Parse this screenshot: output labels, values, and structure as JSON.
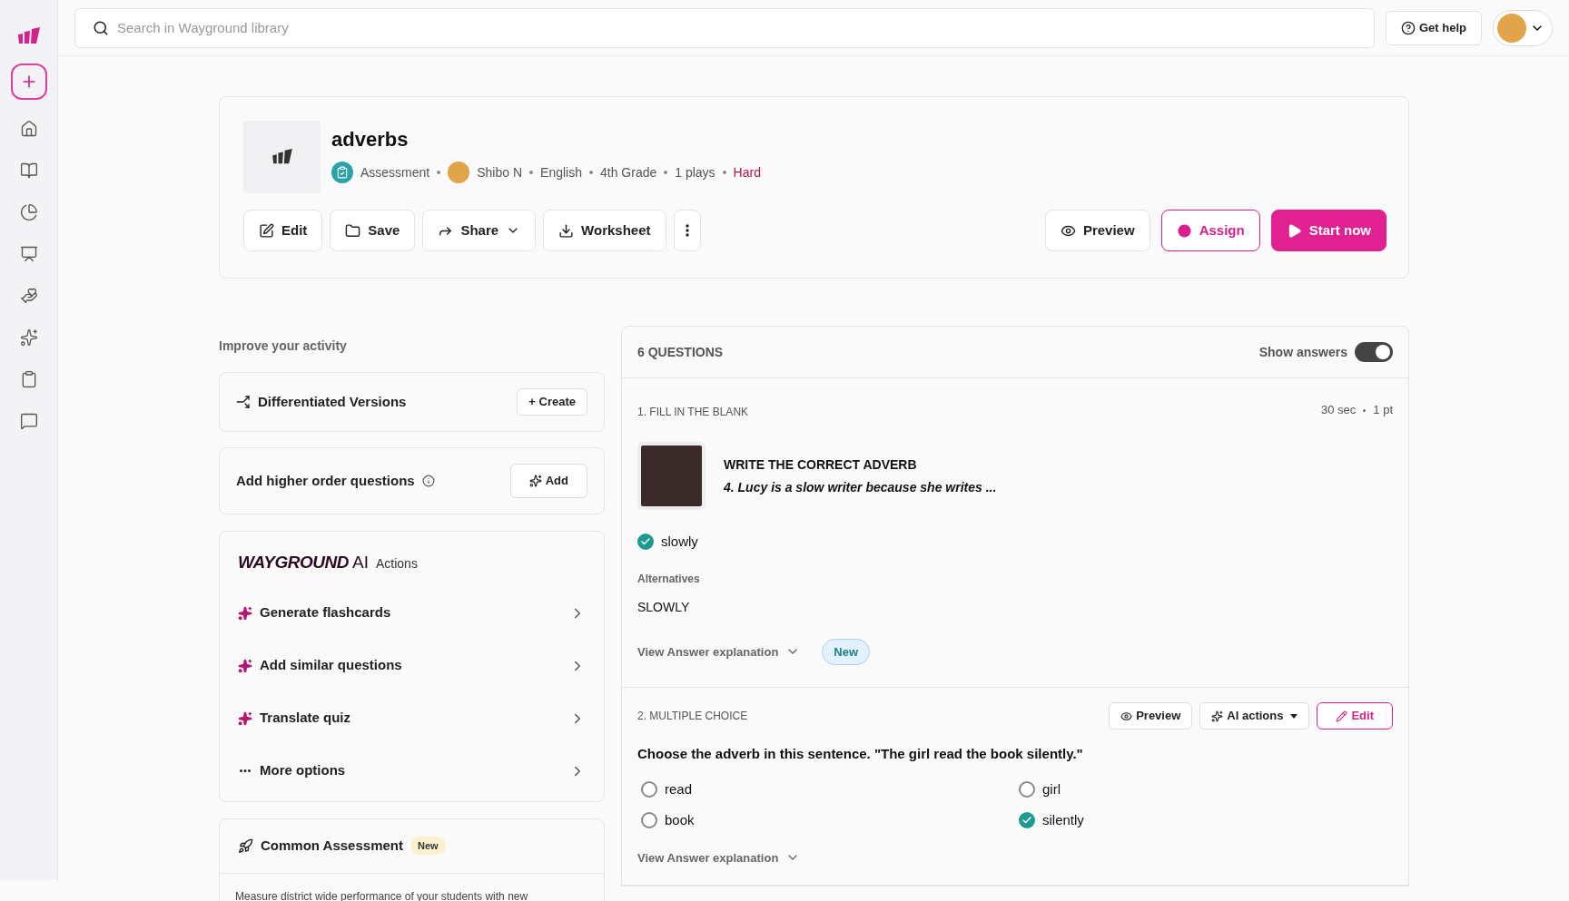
{
  "sidebar": {
    "items": [
      {
        "kind": "create"
      },
      {
        "kind": "home"
      },
      {
        "kind": "library"
      },
      {
        "kind": "reports"
      },
      {
        "kind": "classes"
      },
      {
        "kind": "accommodations"
      },
      {
        "kind": "ai"
      },
      {
        "kind": "assessments"
      },
      {
        "kind": "help"
      }
    ]
  },
  "top_bar": {
    "search": {
      "placeholder": "Search in Wayground library"
    },
    "help_button": "Get help"
  },
  "activity": {
    "title": "adverbs",
    "meta": [
      {
        "kind": "type",
        "text": "Assessment"
      },
      {
        "kind": "author",
        "text": "Shibo N"
      },
      {
        "kind": "plain",
        "text": "English"
      },
      {
        "kind": "plain",
        "text": "4th Grade"
      },
      {
        "kind": "plain",
        "text": "1 plays"
      },
      {
        "kind": "difficulty",
        "text": "Hard"
      }
    ],
    "actions": [
      {
        "kind": "edit",
        "label": "Edit"
      },
      {
        "kind": "save",
        "label": "Save"
      },
      {
        "kind": "share",
        "label": "Share"
      },
      {
        "kind": "worksheet",
        "label": "Worksheet"
      },
      {
        "kind": "more"
      }
    ],
    "primary_actions": [
      {
        "kind": "preview",
        "label": "Preview"
      },
      {
        "kind": "assign",
        "label": "Assign"
      },
      {
        "kind": "start",
        "label": "Start now"
      }
    ]
  },
  "improve": {
    "heading": "Improve your activity",
    "cards": [
      {
        "kind": "versions",
        "label": "Differentiated Versions",
        "button": "+ Create"
      },
      {
        "kind": "higher",
        "label": "Add higher order questions",
        "button": "Add"
      }
    ],
    "ai_panel": {
      "brand": "WAYGROUND",
      "brand_suffix": "AI",
      "label": "Actions",
      "items": [
        {
          "kind": "ai",
          "label": "Generate flashcards"
        },
        {
          "kind": "ai",
          "label": "Add similar questions"
        },
        {
          "kind": "ai",
          "label": "Translate quiz"
        },
        {
          "kind": "more",
          "label": "More options"
        }
      ]
    },
    "common": {
      "label": "Common Assessment",
      "badge": "New",
      "description": "Measure district wide performance of your students with new"
    }
  },
  "questions": {
    "count": "6 QUESTIONS",
    "show_answers": {
      "label": "Show answers",
      "on": true
    },
    "items": [
      {
        "kind": "fill",
        "type_label": "1. FILL IN THE BLANK",
        "time": "30 sec",
        "points": "1 pt",
        "heading": "WRITE THE CORRECT ADVERB",
        "prompt": "4. Lucy is a slow writer because she writes ...",
        "answer": "slowly",
        "alternatives_label": "Alternatives",
        "alternatives": [
          "SLOWLY"
        ],
        "explanation": "View Answer explanation",
        "explanation_badge": "New"
      },
      {
        "kind": "choice",
        "type_label": "2. MULTIPLE CHOICE",
        "buttons": [
          {
            "kind": "preview",
            "label": "Preview"
          },
          {
            "kind": "ai",
            "label": "AI actions"
          },
          {
            "kind": "edit",
            "label": "Edit"
          }
        ],
        "prompt": "Choose the adverb in this sentence. \"The girl read the book silently.\"",
        "options": [
          {
            "text": "read",
            "correct": false
          },
          {
            "text": "girl",
            "correct": false
          },
          {
            "text": "book",
            "correct": false
          },
          {
            "text": "silently",
            "correct": true
          }
        ],
        "explanation": "View Answer explanation"
      }
    ]
  }
}
